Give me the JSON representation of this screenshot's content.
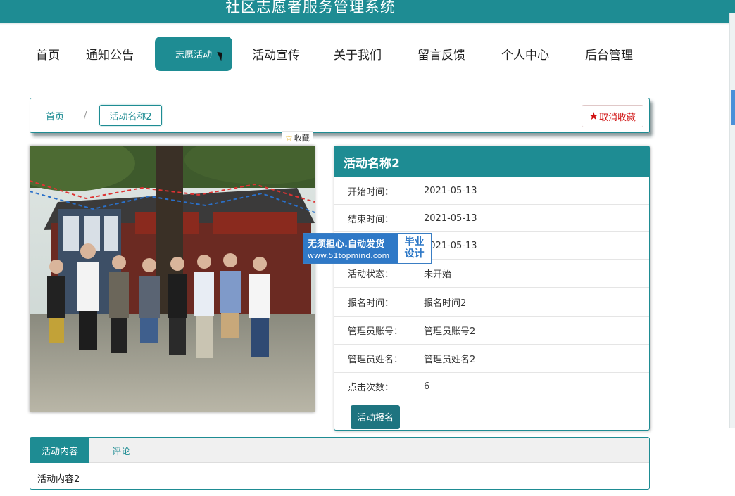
{
  "site": {
    "title": "社区志愿者服务管理系统"
  },
  "nav": {
    "items": [
      {
        "label": "首页"
      },
      {
        "label": "通知公告"
      },
      {
        "label": "志愿活动"
      },
      {
        "label": "活动宣传"
      },
      {
        "label": "关于我们"
      },
      {
        "label": "留言反馈"
      },
      {
        "label": "个人中心"
      },
      {
        "label": "后台管理"
      }
    ],
    "active_index": 2
  },
  "breadcrumb": {
    "home": "首页",
    "separator": "/",
    "current": "活动名称2"
  },
  "unfavorite": {
    "label": "取消收藏",
    "icon": "star-icon"
  },
  "favorite_tag": {
    "label": "收藏",
    "icon": "star-outline-icon"
  },
  "detail": {
    "title": "活动名称2",
    "rows": [
      {
        "label": "开始时间：",
        "value": "2021-05-13"
      },
      {
        "label": "结束时间：",
        "value": "2021-05-13"
      },
      {
        "label": "",
        "value": "2021-05-13"
      },
      {
        "label": "活动状态：",
        "value": "未开始"
      },
      {
        "label": "报名时间：",
        "value": "报名时间2"
      },
      {
        "label": "管理员账号：",
        "value": "管理员账号2"
      },
      {
        "label": "管理员姓名：",
        "value": "管理员姓名2"
      },
      {
        "label": "点击次数：",
        "value": "6"
      }
    ],
    "signup_label": "活动报名"
  },
  "watermark": {
    "line1": "无须担心.自动发货",
    "line2": "www.51topmind.com",
    "right1": "毕业",
    "right2": "设计"
  },
  "tabs": {
    "items": [
      {
        "label": "活动内容"
      },
      {
        "label": "评论"
      }
    ],
    "active_index": 0,
    "content": "活动内容2"
  },
  "colors": {
    "primary": "#1e8c93",
    "button_dark": "#1e7480",
    "danger": "#d01010"
  }
}
